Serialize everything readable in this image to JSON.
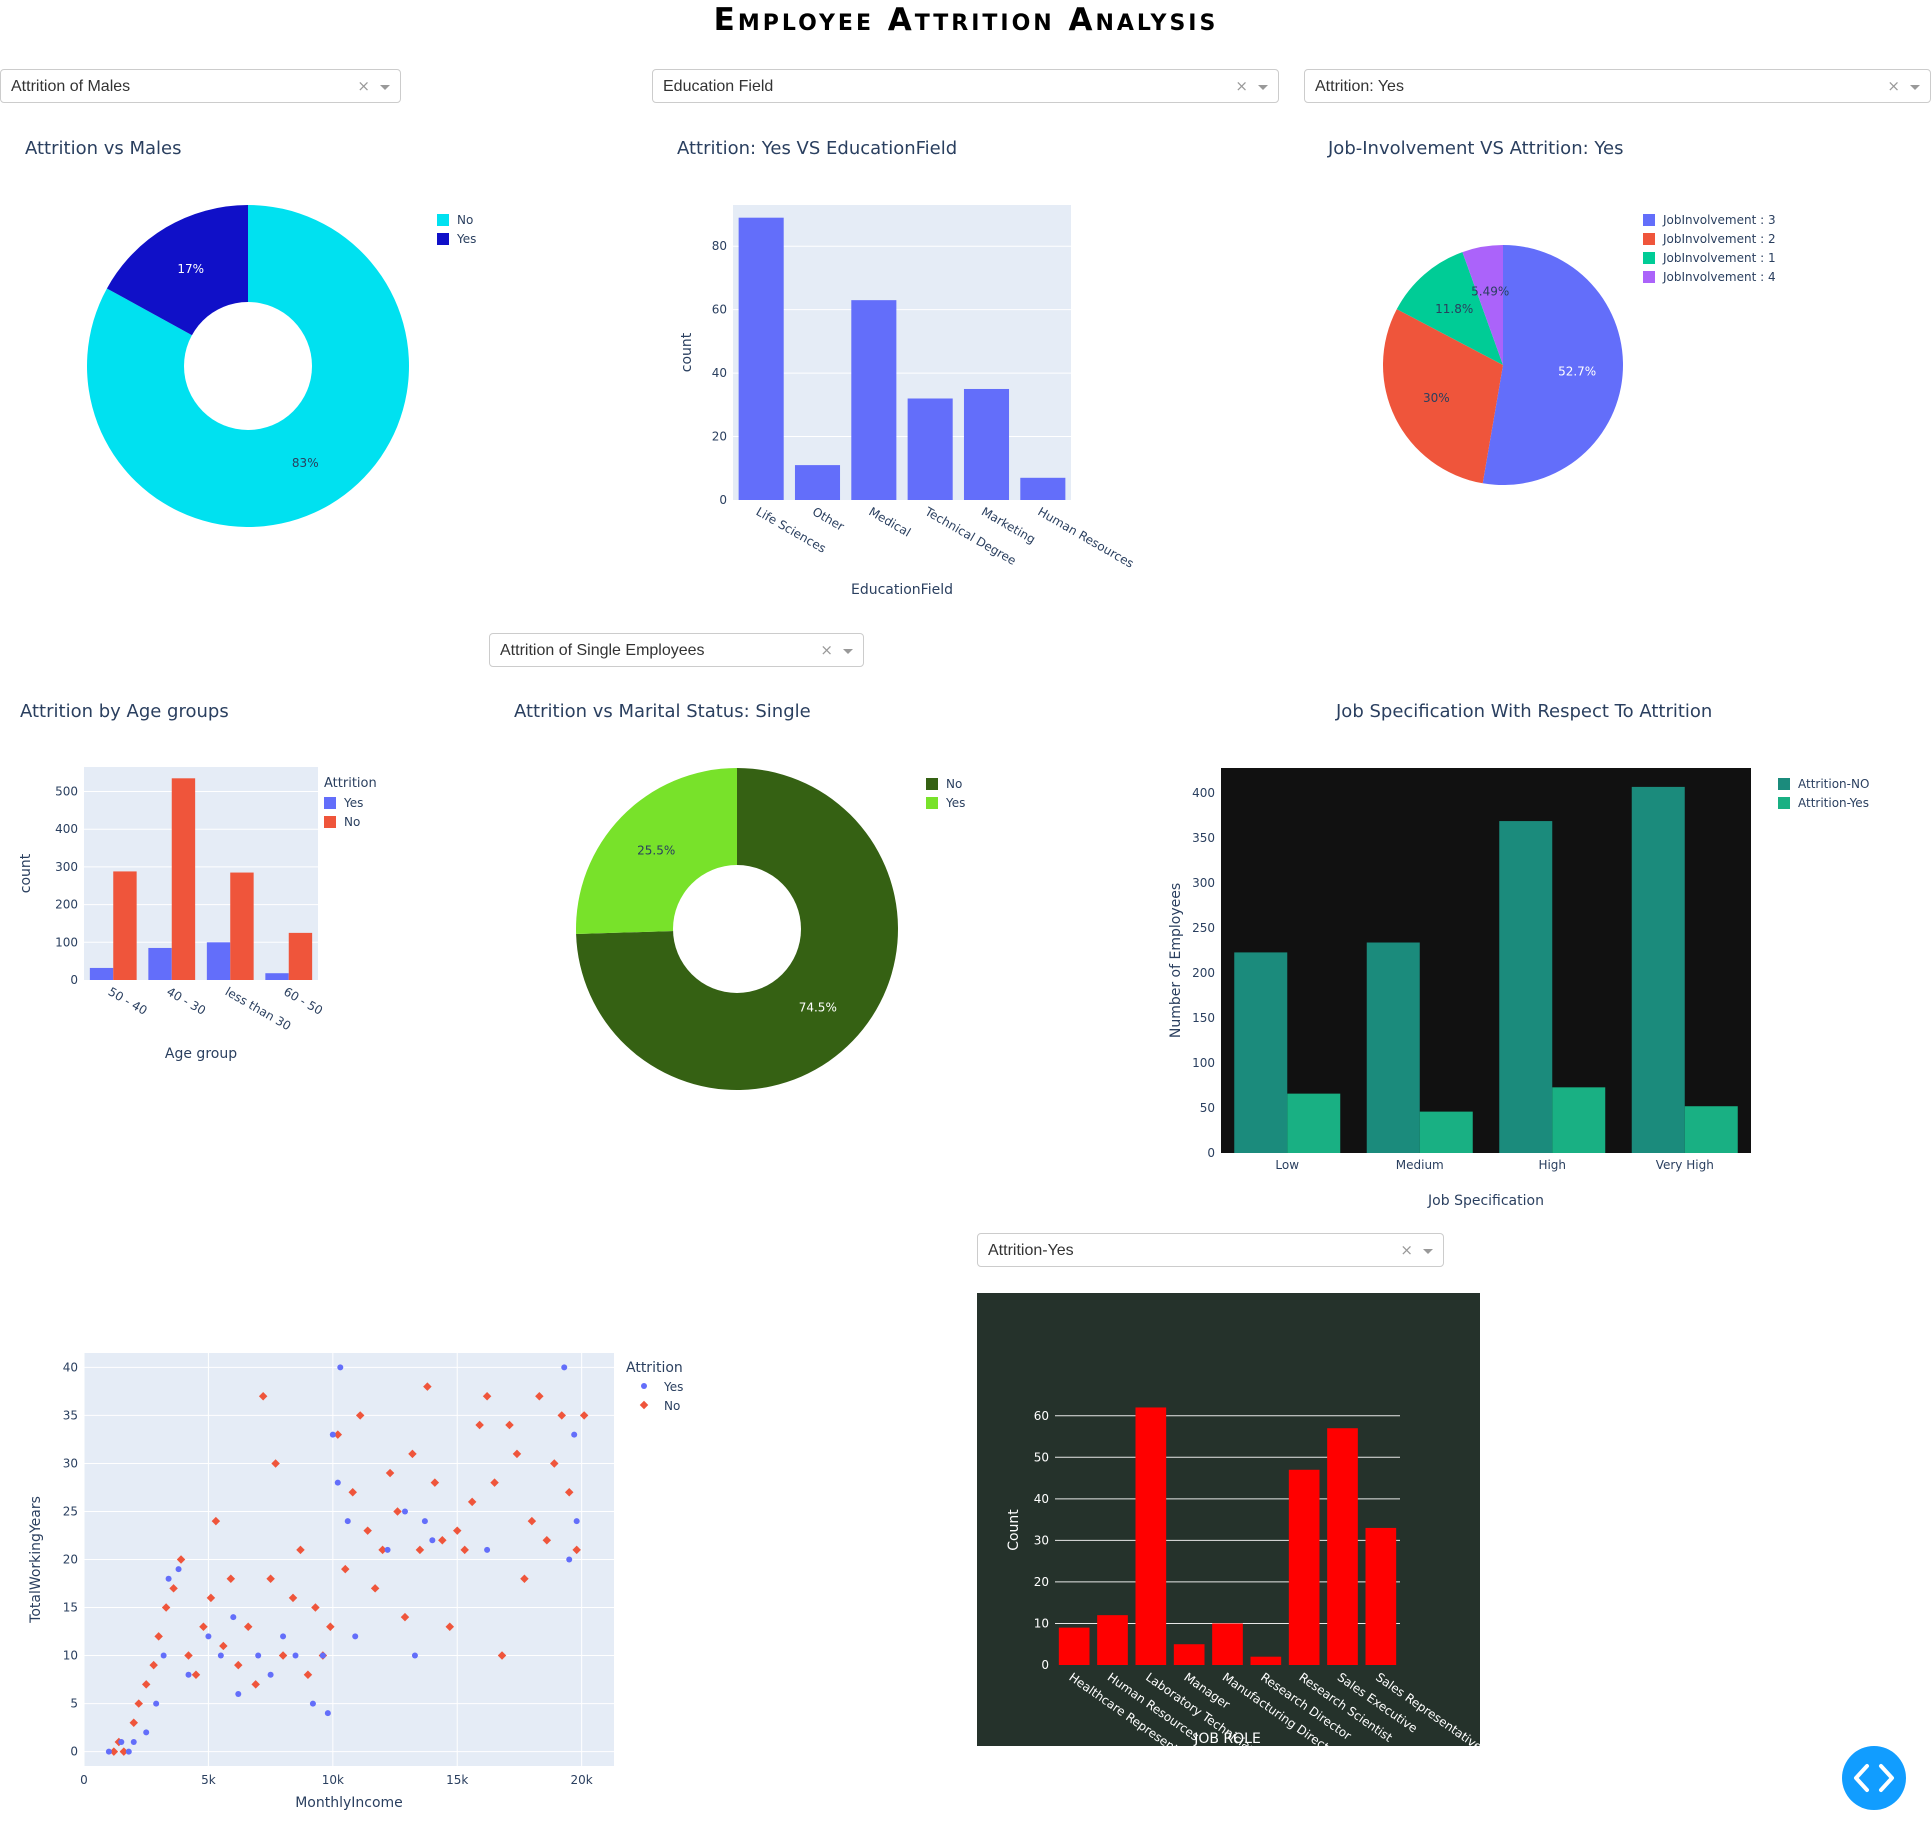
{
  "page": {
    "title": "Employee Attrition Analysis"
  },
  "dropdowns": {
    "gender": {
      "value": "Attrition of Males"
    },
    "education": {
      "value": "Education Field"
    },
    "jobinv": {
      "value": "Attrition: Yes"
    },
    "marital": {
      "value": "Attrition of Single Employees"
    },
    "jobrole": {
      "value": "Attrition-Yes"
    },
    "clear_glyph": "×"
  },
  "charts": {
    "males": {
      "title": "Attrition vs Males",
      "chart_data": {
        "type": "pie",
        "hole": true,
        "labels": [
          "No",
          "Yes"
        ],
        "values": [
          83,
          17
        ],
        "text": [
          "83%",
          "17%"
        ],
        "colors": [
          "#00e1f0",
          "#1010c8"
        ],
        "legend_position": "right"
      }
    },
    "education": {
      "title": "Attrition: Yes VS EducationField",
      "chart_data": {
        "type": "bar",
        "categories": [
          "Life Sciences",
          "Other",
          "Medical",
          "Technical Degree",
          "Marketing",
          "Human Resources"
        ],
        "values": [
          89,
          11,
          63,
          32,
          35,
          7
        ],
        "xlabel": "EducationField",
        "ylabel": "count",
        "ylim": [
          0,
          93
        ],
        "yticks": [
          0,
          20,
          40,
          60,
          80
        ],
        "color": "#636efa",
        "grid": true
      }
    },
    "jobinv": {
      "title": "Job-Involvement VS Attrition: Yes",
      "chart_data": {
        "type": "pie",
        "labels": [
          "JobInvolvement : 3",
          "JobInvolvement : 2",
          "JobInvolvement : 1",
          "JobInvolvement : 4"
        ],
        "values": [
          52.7,
          30,
          11.8,
          5.49
        ],
        "text": [
          "52.7%",
          "30%",
          "11.8%",
          "5.49%"
        ],
        "colors": [
          "#636efa",
          "#ef553b",
          "#00cc96",
          "#ab63fa"
        ],
        "legend_position": "right"
      }
    },
    "age": {
      "title": "Attrition by Age groups",
      "chart_data": {
        "type": "bar",
        "categories": [
          "50 - 40",
          "40 - 30",
          "less than 30",
          "60 - 50"
        ],
        "series": [
          {
            "name": "Yes",
            "values": [
              32,
              85,
              100,
              18
            ],
            "color": "#636efa"
          },
          {
            "name": "No",
            "values": [
              288,
              535,
              285,
              125
            ],
            "color": "#ef553b"
          }
        ],
        "legend_title": "Attrition",
        "xlabel": "Age group",
        "ylabel": "count",
        "ylim": [
          0,
          565
        ],
        "yticks": [
          0,
          100,
          200,
          300,
          400,
          500
        ],
        "grid": true
      }
    },
    "marital": {
      "title": "Attrition vs Marital Status: Single",
      "chart_data": {
        "type": "pie",
        "hole": true,
        "labels": [
          "No",
          "Yes"
        ],
        "values": [
          74.5,
          25.5
        ],
        "text": [
          "74.5%",
          "25.5%"
        ],
        "colors": [
          "#356113",
          "#78e22a"
        ],
        "legend_position": "right"
      }
    },
    "jobspec": {
      "title": "Job Specification With Respect To Attrition",
      "chart_data": {
        "type": "bar",
        "categories": [
          "Low",
          "Medium",
          "High",
          "Very High"
        ],
        "series": [
          {
            "name": "Attrition-NO",
            "values": [
              223,
              234,
              369,
              407
            ],
            "color": "#1b8b7c"
          },
          {
            "name": "Attrition-Yes",
            "values": [
              66,
              46,
              73,
              52
            ],
            "color": "#19b083"
          }
        ],
        "xlabel": "Job Specification",
        "ylabel": "Number of Employees",
        "ylim": [
          0,
          428
        ],
        "yticks": [
          0,
          50,
          100,
          150,
          200,
          250,
          300,
          350,
          400
        ],
        "background": "#111111"
      }
    },
    "scatter": {
      "title": "",
      "chart_data": {
        "type": "scatter",
        "xlabel": "MonthlyIncome",
        "ylabel": "TotalWorkingYears",
        "xlim": [
          0,
          21300
        ],
        "ylim": [
          -1.5,
          41.5
        ],
        "xticks": [
          {
            "v": 0,
            "t": "0"
          },
          {
            "v": 5000,
            "t": "5k"
          },
          {
            "v": 10000,
            "t": "10k"
          },
          {
            "v": 15000,
            "t": "15k"
          },
          {
            "v": 20000,
            "t": "20k"
          }
        ],
        "yticks": [
          0,
          5,
          10,
          15,
          20,
          25,
          30,
          35,
          40
        ],
        "legend_title": "Attrition",
        "series": [
          {
            "name": "Yes",
            "color": "#636efa"
          },
          {
            "name": "No",
            "color": "#ef553b"
          }
        ],
        "yes_points": [
          [
            1000,
            0
          ],
          [
            1500,
            1
          ],
          [
            1800,
            0
          ],
          [
            2000,
            1
          ],
          [
            2500,
            2
          ],
          [
            2900,
            5
          ],
          [
            3200,
            10
          ],
          [
            3400,
            18
          ],
          [
            3800,
            19
          ],
          [
            4200,
            8
          ],
          [
            5000,
            12
          ],
          [
            5500,
            10
          ],
          [
            6000,
            14
          ],
          [
            6200,
            6
          ],
          [
            7000,
            10
          ],
          [
            7500,
            8
          ],
          [
            8000,
            12
          ],
          [
            8500,
            10
          ],
          [
            9200,
            5
          ],
          [
            9600,
            10
          ],
          [
            9800,
            4
          ],
          [
            10000,
            33
          ],
          [
            10300,
            40
          ],
          [
            10200,
            28
          ],
          [
            10600,
            24
          ],
          [
            10900,
            12
          ],
          [
            12200,
            21
          ],
          [
            12900,
            25
          ],
          [
            13300,
            10
          ],
          [
            13700,
            24
          ],
          [
            14000,
            22
          ],
          [
            16200,
            21
          ],
          [
            19300,
            40
          ],
          [
            19700,
            33
          ],
          [
            19800,
            24
          ],
          [
            19500,
            20
          ]
        ],
        "no_points": [
          [
            1200,
            0
          ],
          [
            1400,
            1
          ],
          [
            1600,
            0
          ],
          [
            2000,
            3
          ],
          [
            2200,
            5
          ],
          [
            2500,
            7
          ],
          [
            2800,
            9
          ],
          [
            3000,
            12
          ],
          [
            3300,
            15
          ],
          [
            3600,
            17
          ],
          [
            3900,
            20
          ],
          [
            4200,
            10
          ],
          [
            4500,
            8
          ],
          [
            4800,
            13
          ],
          [
            5100,
            16
          ],
          [
            5300,
            24
          ],
          [
            5600,
            11
          ],
          [
            5900,
            18
          ],
          [
            6200,
            9
          ],
          [
            6600,
            13
          ],
          [
            6900,
            7
          ],
          [
            7200,
            37
          ],
          [
            7500,
            18
          ],
          [
            7700,
            30
          ],
          [
            8000,
            10
          ],
          [
            8400,
            16
          ],
          [
            8700,
            21
          ],
          [
            9000,
            8
          ],
          [
            9300,
            15
          ],
          [
            9600,
            10
          ],
          [
            9900,
            13
          ],
          [
            10200,
            33
          ],
          [
            10500,
            19
          ],
          [
            10800,
            27
          ],
          [
            11100,
            35
          ],
          [
            11400,
            23
          ],
          [
            11700,
            17
          ],
          [
            12000,
            21
          ],
          [
            12300,
            29
          ],
          [
            12600,
            25
          ],
          [
            12900,
            14
          ],
          [
            13200,
            31
          ],
          [
            13500,
            21
          ],
          [
            13800,
            38
          ],
          [
            14100,
            28
          ],
          [
            14400,
            22
          ],
          [
            14700,
            13
          ],
          [
            15000,
            23
          ],
          [
            15300,
            21
          ],
          [
            15600,
            26
          ],
          [
            15900,
            34
          ],
          [
            16200,
            37
          ],
          [
            16500,
            28
          ],
          [
            16800,
            10
          ],
          [
            17100,
            34
          ],
          [
            17400,
            31
          ],
          [
            17700,
            18
          ],
          [
            18000,
            24
          ],
          [
            18300,
            37
          ],
          [
            18600,
            22
          ],
          [
            18900,
            30
          ],
          [
            19200,
            35
          ],
          [
            19500,
            27
          ],
          [
            19800,
            21
          ],
          [
            20100,
            35
          ]
        ]
      }
    },
    "jobrole": {
      "title": "",
      "chart_data": {
        "type": "bar",
        "categories": [
          "Healthcare Representative",
          "Human Resources",
          "Laboratory Technician",
          "Manager",
          "Manufacturing Director",
          "Research Director",
          "Research Scientist",
          "Sales Executive",
          "Sales Representative"
        ],
        "values": [
          9,
          12,
          62,
          5,
          10,
          2,
          47,
          57,
          33
        ],
        "xlabel": "JOB ROLE",
        "ylabel": "Count",
        "ylim": [
          0,
          65
        ],
        "yticks": [
          0,
          10,
          20,
          30,
          40,
          50,
          60
        ],
        "color": "#ff0000",
        "background": "#25322b"
      }
    }
  }
}
